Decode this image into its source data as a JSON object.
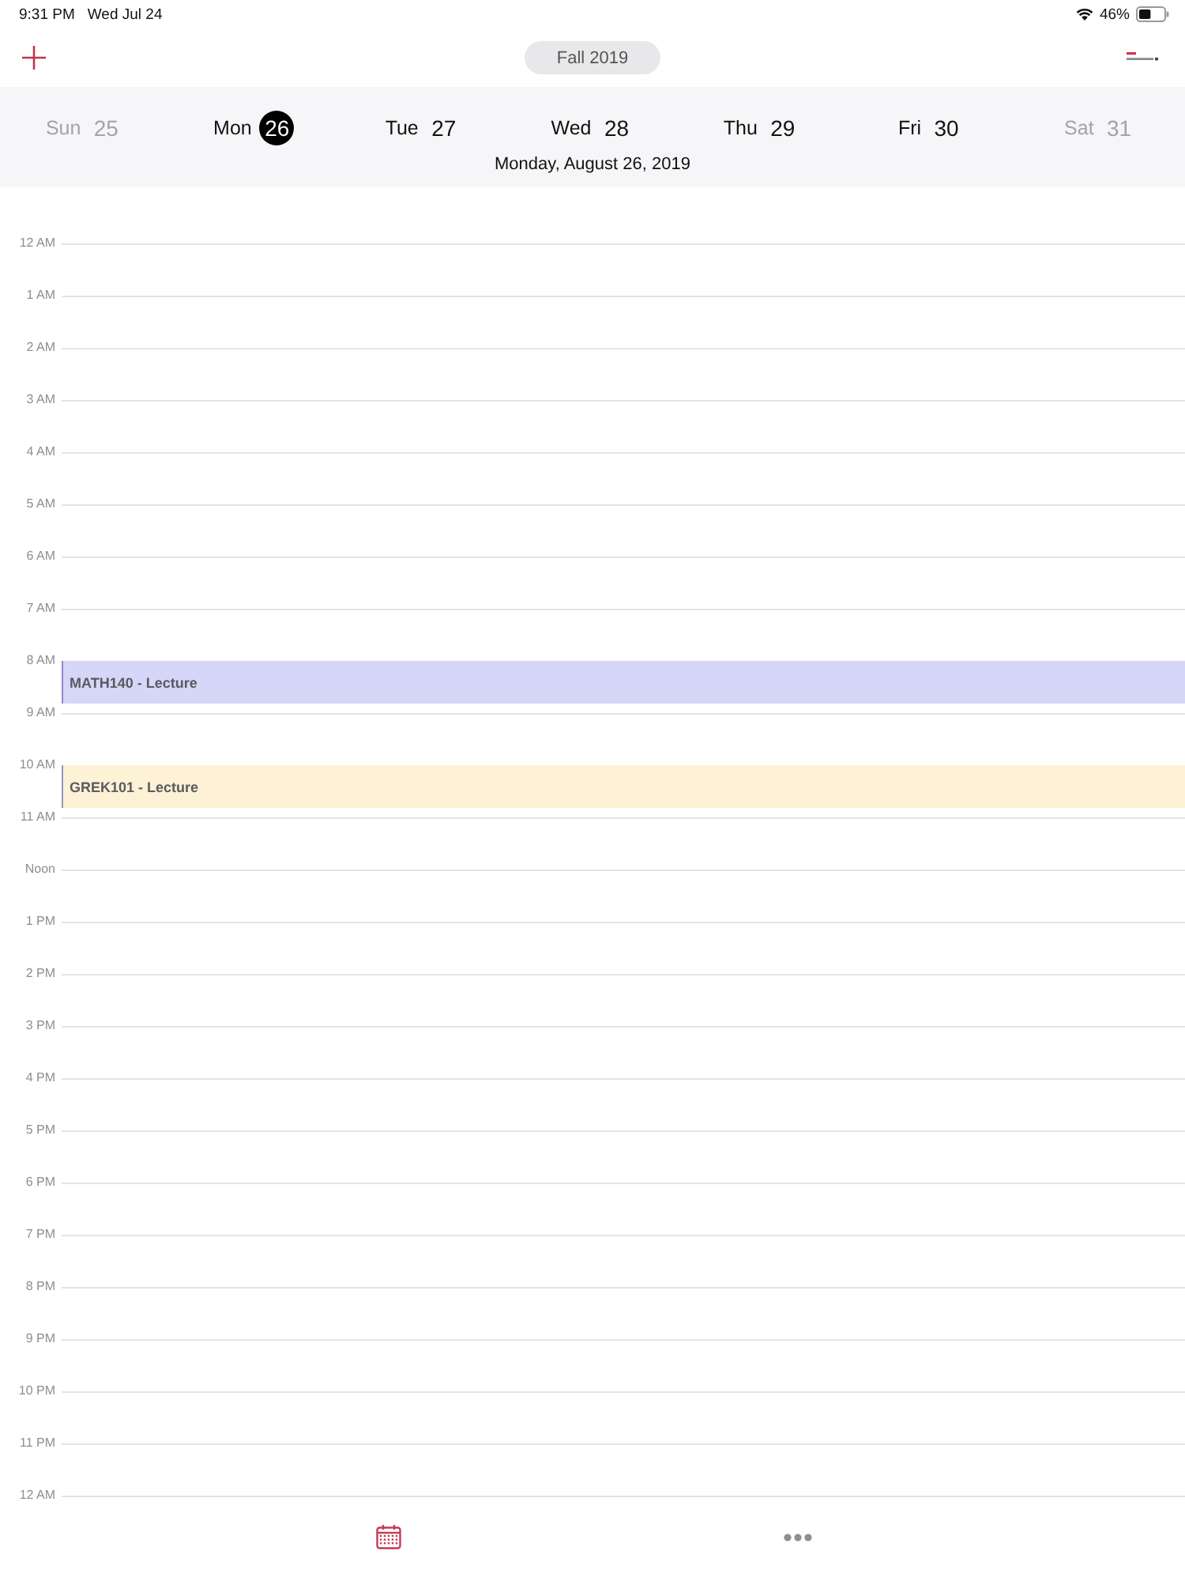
{
  "status_bar": {
    "time": "9:31 PM",
    "date": "Wed Jul 24",
    "battery_text": "46%"
  },
  "nav": {
    "term": "Fall 2019"
  },
  "week": {
    "days": [
      {
        "name": "Sun",
        "number": "25",
        "weekend": true,
        "selected": false
      },
      {
        "name": "Mon",
        "number": "26",
        "weekend": false,
        "selected": true
      },
      {
        "name": "Tue",
        "number": "27",
        "weekend": false,
        "selected": false
      },
      {
        "name": "Wed",
        "number": "28",
        "weekend": false,
        "selected": false
      },
      {
        "name": "Thu",
        "number": "29",
        "weekend": false,
        "selected": false
      },
      {
        "name": "Fri",
        "number": "30",
        "weekend": false,
        "selected": false
      },
      {
        "name": "Sat",
        "number": "31",
        "weekend": true,
        "selected": false
      }
    ],
    "selected_date": "Monday, August 26, 2019"
  },
  "timeline": {
    "hours": [
      {
        "label": "12 AM"
      },
      {
        "label": "1 AM"
      },
      {
        "label": "2 AM"
      },
      {
        "label": "3 AM"
      },
      {
        "label": "4 AM"
      },
      {
        "label": "5 AM"
      },
      {
        "label": "6 AM"
      },
      {
        "label": "7 AM"
      },
      {
        "label": "8 AM",
        "events": [
          {
            "title": "MATH140 - Lecture",
            "color": "#d6d6f8"
          }
        ]
      },
      {
        "label": "9 AM"
      },
      {
        "label": "10 AM",
        "events": [
          {
            "title": "GREK101 - Lecture",
            "color": "#fdf1d6"
          }
        ]
      },
      {
        "label": "11 AM"
      },
      {
        "label": "Noon"
      },
      {
        "label": "1 PM"
      },
      {
        "label": "2 PM"
      },
      {
        "label": "3 PM"
      },
      {
        "label": "4 PM"
      },
      {
        "label": "5 PM"
      },
      {
        "label": "6 PM"
      },
      {
        "label": "7 PM"
      },
      {
        "label": "8 PM"
      },
      {
        "label": "9 PM"
      },
      {
        "label": "10 PM"
      },
      {
        "label": "11 PM"
      },
      {
        "label": "12 AM"
      }
    ]
  },
  "tab_bar": {
    "items": [
      {
        "kind": "calendar",
        "selected": true
      },
      {
        "kind": "more",
        "selected": false
      }
    ]
  }
}
